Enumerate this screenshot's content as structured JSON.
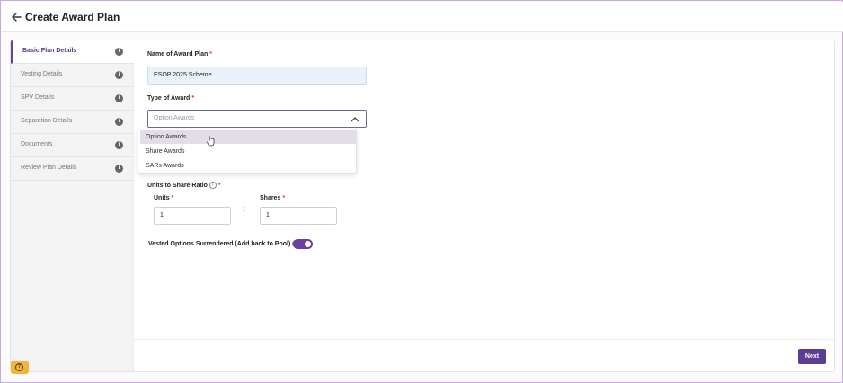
{
  "header": {
    "title": "Create Award Plan"
  },
  "sidebar": {
    "items": [
      {
        "label": "Basic Plan Details",
        "info": "i"
      },
      {
        "label": "Vesting Details",
        "info": "i"
      },
      {
        "label": "SPV Details",
        "info": "i"
      },
      {
        "label": "Separation Details",
        "info": "i"
      },
      {
        "label": "Documents",
        "info": "i"
      },
      {
        "label": "Review Plan Details",
        "info": "i"
      }
    ],
    "active_index": 0
  },
  "form": {
    "name_label": "Name of Award Plan",
    "name_value": "ESOP 2025 Scheme",
    "type_label": "Type of Award",
    "type_placeholder": "Option Awards",
    "type_options": [
      "Option Awards",
      "Share Awards",
      "SARs Awards"
    ],
    "ratio_label": "Units to Share Ratio",
    "units_label": "Units",
    "units_value": "1",
    "colon": ":",
    "shares_label": "Shares",
    "shares_value": "1",
    "surrendered_label": "Vested Options Surrendered (Add back to Pool)",
    "surrendered_enabled": true,
    "required_mark": "*",
    "help_glyph": "i"
  },
  "footer": {
    "next_label": "Next"
  },
  "help": {
    "glyph": "?"
  },
  "colors": {
    "accent": "#5b3d93",
    "required": "#d9363e",
    "help": "#f0b43c"
  }
}
